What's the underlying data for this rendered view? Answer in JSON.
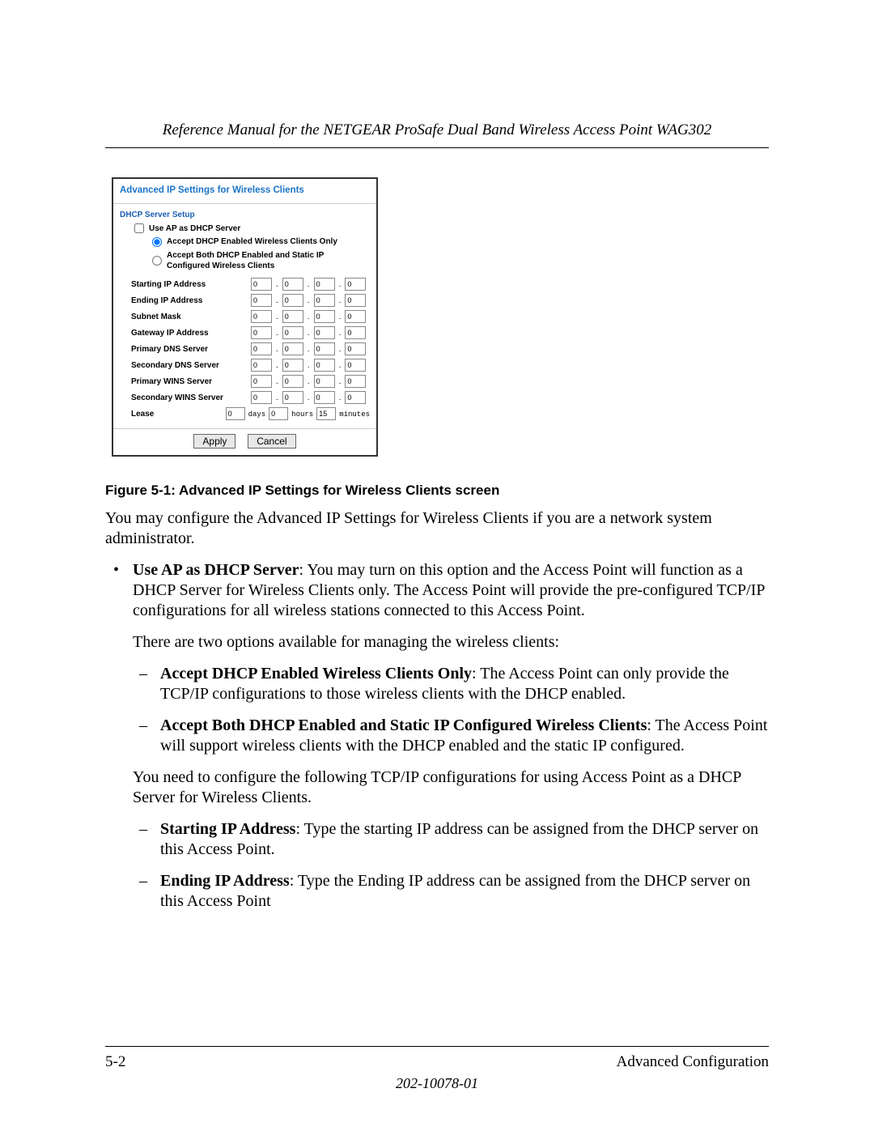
{
  "header_title": "Reference Manual for the NETGEAR ProSafe Dual Band Wireless Access Point WAG302",
  "panel": {
    "title": "Advanced IP Settings for Wireless Clients",
    "section_title": "DHCP Server Setup",
    "checkbox_label": "Use AP as DHCP Server",
    "radio1_label": "Accept DHCP Enabled Wireless Clients Only",
    "radio2_label": "Accept Both DHCP Enabled and Static IP Configured Wireless Clients",
    "ip_rows": [
      {
        "label": "Starting IP Address",
        "octets": [
          "0",
          "0",
          "0",
          "0"
        ]
      },
      {
        "label": "Ending IP Address",
        "octets": [
          "0",
          "0",
          "0",
          "0"
        ]
      },
      {
        "label": "Subnet Mask",
        "octets": [
          "0",
          "0",
          "0",
          "0"
        ]
      },
      {
        "label": "Gateway IP Address",
        "octets": [
          "0",
          "0",
          "0",
          "0"
        ]
      },
      {
        "label": "Primary DNS Server",
        "octets": [
          "0",
          "0",
          "0",
          "0"
        ]
      },
      {
        "label": "Secondary DNS Server",
        "octets": [
          "0",
          "0",
          "0",
          "0"
        ]
      },
      {
        "label": "Primary WINS Server",
        "octets": [
          "0",
          "0",
          "0",
          "0"
        ]
      },
      {
        "label": "Secondary WINS Server",
        "octets": [
          "0",
          "0",
          "0",
          "0"
        ]
      }
    ],
    "lease": {
      "label": "Lease",
      "days": "0",
      "days_label": "days",
      "hours": "0",
      "hours_label": "hours",
      "minutes": "15",
      "minutes_label": "minutes"
    },
    "apply": "Apply",
    "cancel": "Cancel"
  },
  "caption": "Figure 5-1: Advanced IP Settings for Wireless Clients screen",
  "body": {
    "intro": "You may configure the Advanced IP Settings for Wireless Clients if you are a network system administrator.",
    "b1_bold": "Use AP as DHCP Server",
    "b1_text": ": You may turn on this option and the Access Point will function as a DHCP Server for Wireless Clients only. The Access Point will provide the pre-configured TCP/IP configurations for all wireless stations connected to this Access Point.",
    "b1_p2": "There are two options available for managing the wireless clients:",
    "b1_s1_bold": "Accept DHCP Enabled Wireless Clients Only",
    "b1_s1_text": ": The Access Point can only provide the TCP/IP configurations to those wireless clients with the DHCP enabled.",
    "b1_s2_bold": "Accept Both DHCP Enabled and Static IP Configured Wireless Clients",
    "b1_s2_text": ": The Access Point will support wireless clients with the DHCP enabled and the static IP configured.",
    "b1_p3": "You need to configure the following TCP/IP configurations for using Access Point as a DHCP Server for Wireless Clients.",
    "b1_s3_bold": "Starting IP Address",
    "b1_s3_text": ": Type the starting IP address can be assigned from the DHCP server on this Access Point.",
    "b1_s4_bold": "Ending IP Address",
    "b1_s4_text": ": Type the Ending IP address can be assigned from the DHCP server on this Access Point"
  },
  "footer": {
    "page": "5-2",
    "section": "Advanced Configuration",
    "docnum": "202-10078-01"
  }
}
